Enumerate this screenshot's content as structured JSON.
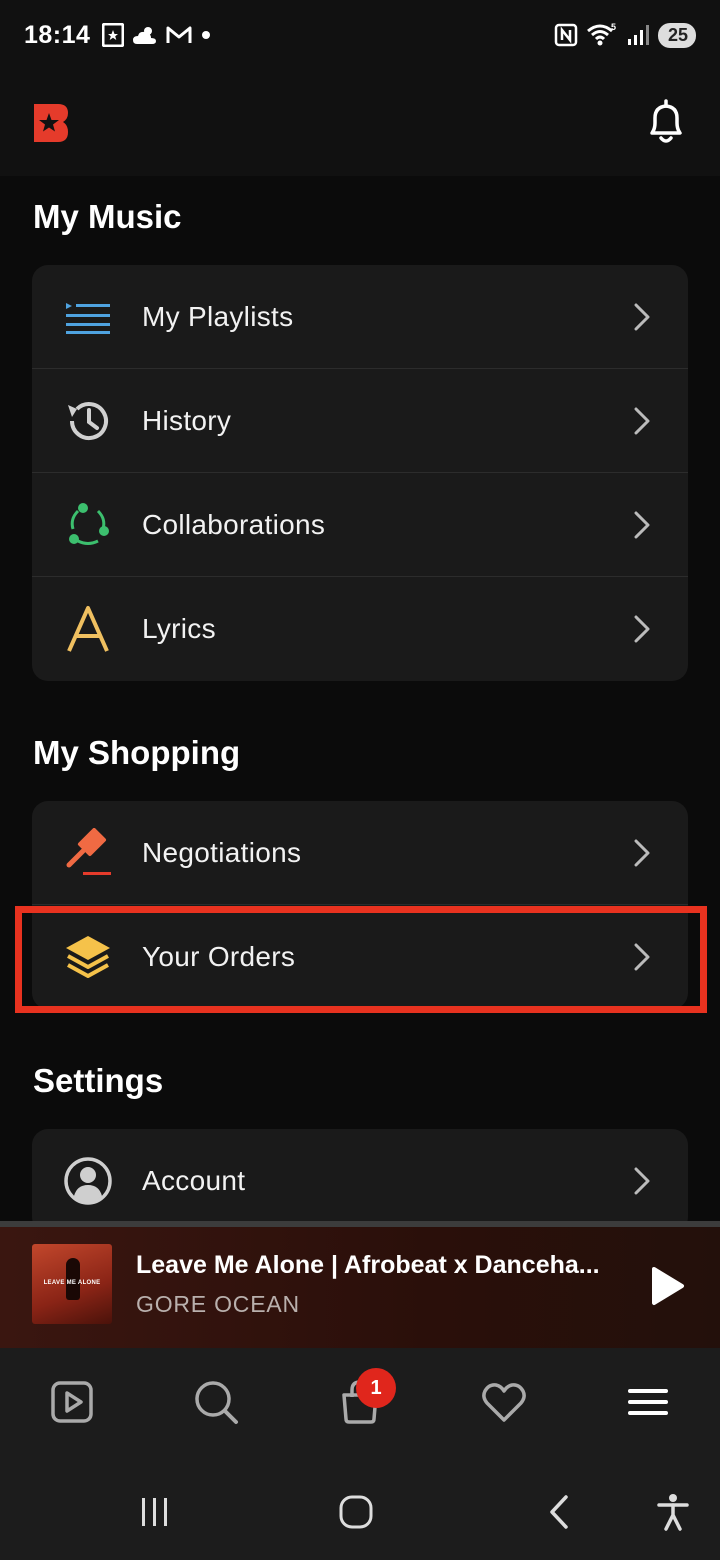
{
  "status_bar": {
    "time": "18:14",
    "battery": "25",
    "icons": [
      "b-app-icon",
      "weather-icon",
      "gmail-icon",
      "dot-icon",
      "nfc-icon",
      "wifi-icon",
      "signal-icon",
      "battery-icon"
    ]
  },
  "header": {
    "logo": "app-logo",
    "bell_icon": "bell-icon"
  },
  "sections": {
    "my_music": {
      "title": "My Music",
      "items": [
        {
          "label": "My Playlists",
          "icon": "playlist-icon",
          "color": "#4fa3e0"
        },
        {
          "label": "History",
          "icon": "history-icon",
          "color": "#d0d0d0"
        },
        {
          "label": "Collaborations",
          "icon": "collaboration-icon",
          "color": "#3cbf6e"
        },
        {
          "label": "Lyrics",
          "icon": "lyrics-icon",
          "color": "#f0c060"
        }
      ]
    },
    "my_shopping": {
      "title": "My Shopping",
      "items": [
        {
          "label": "Negotiations",
          "icon": "gavel-icon",
          "color": "#f06a43"
        },
        {
          "label": "Your Orders",
          "icon": "layers-icon",
          "color": "#f5c24a"
        }
      ]
    },
    "settings": {
      "title": "Settings",
      "items": [
        {
          "label": "Account",
          "icon": "account-icon",
          "color": "#cfcfcf"
        }
      ]
    }
  },
  "mini_player": {
    "track_title": "Leave Me Alone | Afrobeat x Danceha...",
    "artist": "GORE OCEAN",
    "album_art_text": "LEAVE ME ALONE"
  },
  "bottom_nav": {
    "items": [
      "video-icon",
      "search-icon",
      "cart-icon",
      "heart-icon",
      "menu-icon"
    ],
    "cart_badge": "1"
  },
  "system_nav": {
    "items": [
      "recents-icon",
      "home-icon",
      "back-icon",
      "accessibility-icon"
    ]
  },
  "colors": {
    "highlight": "#e8321f",
    "card_bg": "#1a1a1a",
    "badge": "#e0261c"
  }
}
